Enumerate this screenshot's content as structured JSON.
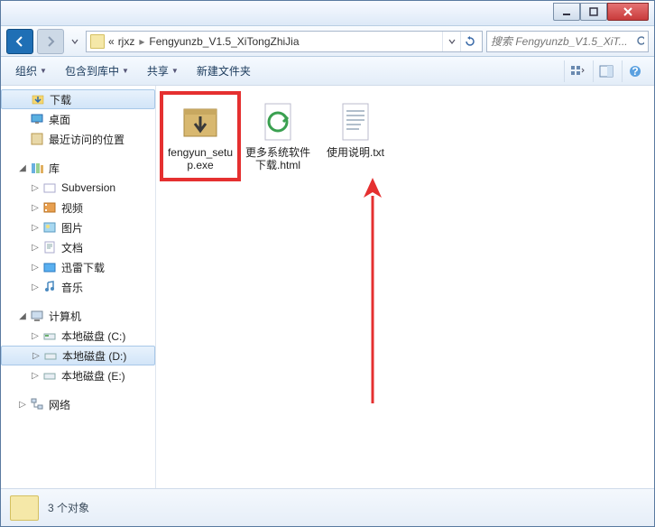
{
  "titlebar": {},
  "nav": {
    "breadcrumb_prefix": "«",
    "crumbs": [
      "rjxz",
      "Fengyunzb_V1.5_XiTongZhiJia"
    ]
  },
  "search": {
    "placeholder": "搜索 Fengyunzb_V1.5_XiT..."
  },
  "toolbar": {
    "organize": "组织",
    "include": "包含到库中",
    "share": "共享",
    "newfolder": "新建文件夹"
  },
  "sidebar": {
    "fav": {
      "downloads": "下载",
      "desktop": "桌面",
      "recent": "最近访问的位置"
    },
    "lib": {
      "label": "库",
      "subversion": "Subversion",
      "videos": "视频",
      "pictures": "图片",
      "documents": "文档",
      "xunlei": "迅雷下载",
      "music": "音乐"
    },
    "computer": {
      "label": "计算机",
      "c": "本地磁盘 (C:)",
      "d": "本地磁盘 (D:)",
      "e": "本地磁盘 (E:)"
    },
    "network": {
      "label": "网络"
    }
  },
  "files": [
    {
      "name": "fengyun_setup.exe",
      "type": "exe"
    },
    {
      "name": "更多系统软件下载.html",
      "type": "html"
    },
    {
      "name": "使用说明.txt",
      "type": "txt"
    }
  ],
  "status": {
    "count_text": "3 个对象"
  }
}
